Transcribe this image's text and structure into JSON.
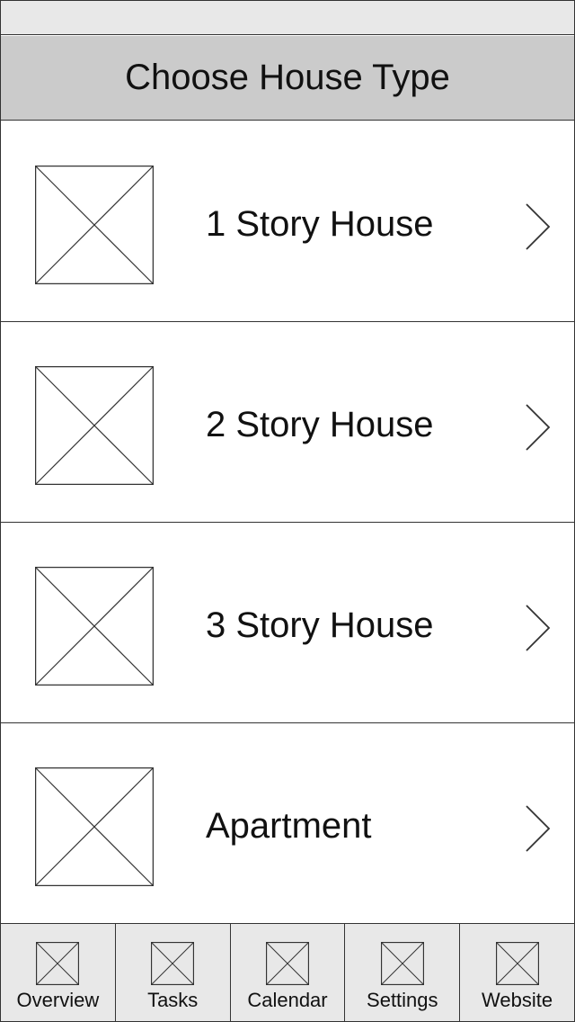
{
  "header": {
    "title": "Choose House Type"
  },
  "house_types": [
    {
      "label": "1 Story House",
      "image_icon": "image-placeholder-icon",
      "chevron_icon": "chevron-right-icon"
    },
    {
      "label": "2 Story House",
      "image_icon": "image-placeholder-icon",
      "chevron_icon": "chevron-right-icon"
    },
    {
      "label": "3 Story House",
      "image_icon": "image-placeholder-icon",
      "chevron_icon": "chevron-right-icon"
    },
    {
      "label": "Apartment",
      "image_icon": "image-placeholder-icon",
      "chevron_icon": "chevron-right-icon"
    }
  ],
  "tabbar": {
    "tabs": [
      {
        "label": "Overview",
        "icon": "image-placeholder-icon"
      },
      {
        "label": "Tasks",
        "icon": "image-placeholder-icon"
      },
      {
        "label": "Calendar",
        "icon": "image-placeholder-icon"
      },
      {
        "label": "Settings",
        "icon": "image-placeholder-icon"
      },
      {
        "label": "Website",
        "icon": "image-placeholder-icon"
      }
    ]
  },
  "colors": {
    "status_bar": "#e8e8e8",
    "header_bg": "#cbcbcb",
    "tabbar_bg": "#e8e8e8",
    "line": "#333333",
    "text": "#111111"
  }
}
